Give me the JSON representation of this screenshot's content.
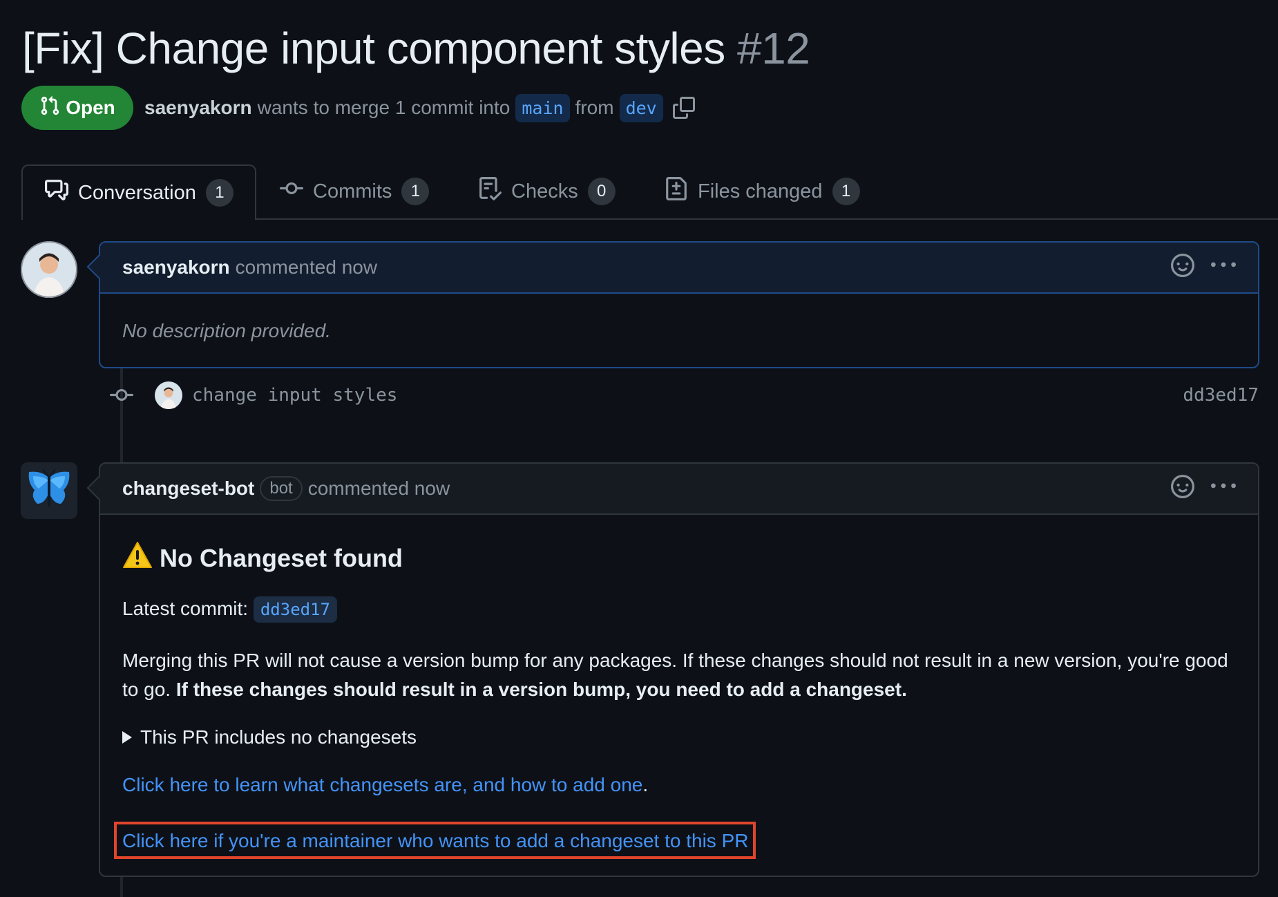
{
  "pr": {
    "title": "[Fix] Change input component styles",
    "number": "#12",
    "state": "Open",
    "author": "saenyakorn",
    "merge_text": "wants to merge 1 commit into",
    "base_branch": "main",
    "from_text": "from",
    "head_branch": "dev"
  },
  "tabs": [
    {
      "label": "Conversation",
      "count": "1"
    },
    {
      "label": "Commits",
      "count": "1"
    },
    {
      "label": "Checks",
      "count": "0"
    },
    {
      "label": "Files changed",
      "count": "1"
    }
  ],
  "first_comment": {
    "author": "saenyakorn",
    "action": "commented now",
    "body": "No description provided."
  },
  "commit": {
    "message": "change input styles",
    "sha": "dd3ed17"
  },
  "bot_comment": {
    "author": "changeset-bot",
    "label": "bot",
    "action": "commented now",
    "heading": "No Changeset found",
    "latest_commit_label": "Latest commit:",
    "latest_commit_sha": "dd3ed17",
    "paragraph_plain": "Merging this PR will not cause a version bump for any packages. If these changes should not result in a new version, you're good to go.",
    "paragraph_bold": "If these changes should result in a version bump, you need to add a changeset.",
    "details_summary": "This PR includes no changesets",
    "learn_link": "Click here to learn what changesets are, and how to add one",
    "learn_period": ".",
    "maintainer_link": "Click here if you're a maintainer who wants to add a changeset to this PR"
  },
  "colors": {
    "background": "#0d1117",
    "open_green": "#238636",
    "link_blue": "#4493f8",
    "highlight_red": "#e0452c"
  }
}
